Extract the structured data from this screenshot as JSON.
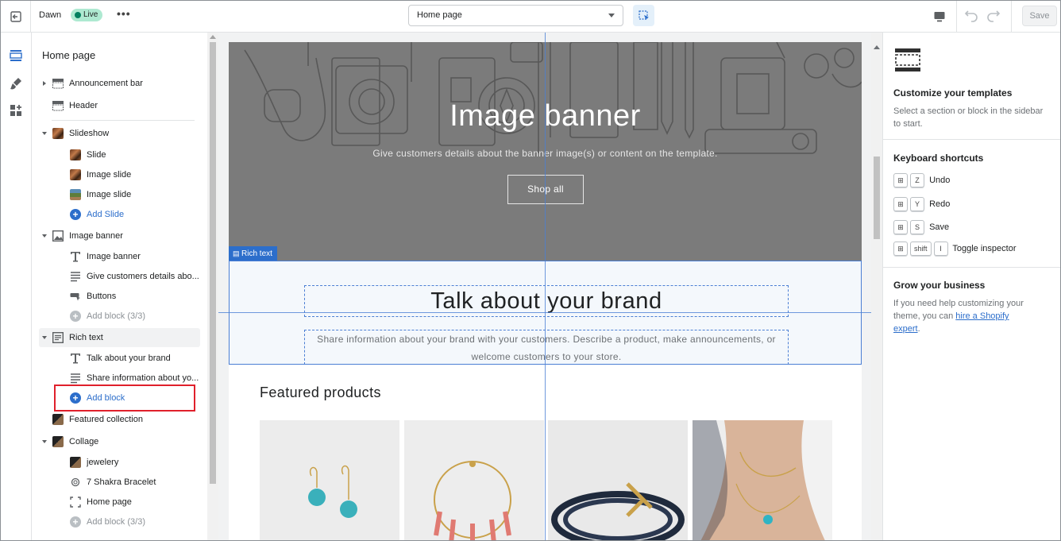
{
  "topbar": {
    "theme_name": "Dawn",
    "status_badge": "Live",
    "more_label": "•••",
    "page_selector_value": "Home page",
    "save_label": "Save"
  },
  "sidebar": {
    "title": "Home page",
    "items": [
      {
        "label": "Announcement bar",
        "type": "section",
        "expand": "collapsed",
        "icon": "layout-top-icon"
      },
      {
        "label": "Header",
        "type": "section",
        "expand": "none",
        "icon": "layout-top-icon"
      },
      {
        "label": "Slideshow",
        "type": "section",
        "expand": "expanded",
        "icon": "slideshow-thumbnail"
      },
      {
        "label": "Slide",
        "type": "block",
        "icon": "image-thumbnail"
      },
      {
        "label": "Image slide",
        "type": "block",
        "icon": "image-thumbnail"
      },
      {
        "label": "Image slide",
        "type": "block",
        "icon": "landscape-thumbnail"
      },
      {
        "label": "Add Slide",
        "type": "add"
      },
      {
        "label": "Image banner",
        "type": "section",
        "expand": "expanded",
        "icon": "image-icon"
      },
      {
        "label": "Image banner",
        "type": "block",
        "icon": "text-icon"
      },
      {
        "label": "Give customers details abo...",
        "type": "block",
        "icon": "paragraph-icon"
      },
      {
        "label": "Buttons",
        "type": "block",
        "icon": "button-icon"
      },
      {
        "label": "Add block (3/3)",
        "type": "add-disabled"
      },
      {
        "label": "Rich text",
        "type": "section",
        "expand": "expanded",
        "icon": "rich-text-icon"
      },
      {
        "label": "Talk about your brand",
        "type": "block",
        "icon": "text-icon"
      },
      {
        "label": "Share information about yo...",
        "type": "block",
        "icon": "paragraph-icon"
      },
      {
        "label": "Add block",
        "type": "add"
      },
      {
        "label": "Featured collection",
        "type": "section",
        "expand": "none",
        "icon": "collection-thumbnail"
      },
      {
        "label": "Collage",
        "type": "section",
        "expand": "expanded",
        "icon": "collection-thumbnail"
      },
      {
        "label": "jewelery",
        "type": "block",
        "icon": "collection-thumbnail"
      },
      {
        "label": "7 Shakra Bracelet",
        "type": "block",
        "icon": "product-icon"
      },
      {
        "label": "Home page",
        "type": "block",
        "icon": "frame-icon"
      },
      {
        "label": "Add block (3/3)",
        "type": "add-disabled"
      }
    ]
  },
  "preview": {
    "banner_title": "Image banner",
    "banner_subtitle": "Give customers details about the banner image(s) or content on the template.",
    "banner_button": "Shop all",
    "section_tag": "Rich text",
    "rich_heading": "Talk about your brand",
    "rich_text": "Share information about your brand with your customers. Describe a product, make announcements, or welcome customers to your store.",
    "featured_title": "Featured products"
  },
  "rpanel": {
    "customize_title": "Customize your templates",
    "customize_text": "Select a section or block in the sidebar to start.",
    "shortcuts_title": "Keyboard shortcuts",
    "shortcuts": [
      {
        "keys": [
          "⊞",
          "Z"
        ],
        "label": "Undo"
      },
      {
        "keys": [
          "⊞",
          "Y"
        ],
        "label": "Redo"
      },
      {
        "keys": [
          "⊞",
          "S"
        ],
        "label": "Save"
      },
      {
        "keys": [
          "⊞",
          "shift",
          "I"
        ],
        "label": "Toggle inspector"
      }
    ],
    "grow_title": "Grow your business",
    "grow_text_before": "If you need help customizing your theme, you can",
    "grow_link": "hire a Shopify expert",
    "grow_text_after": "."
  },
  "colors": {
    "accent": "#2c6ecb",
    "live_badge": "#aee9d1",
    "banner_overlay": "#7b7b7b",
    "highlight": "#e0202b"
  }
}
